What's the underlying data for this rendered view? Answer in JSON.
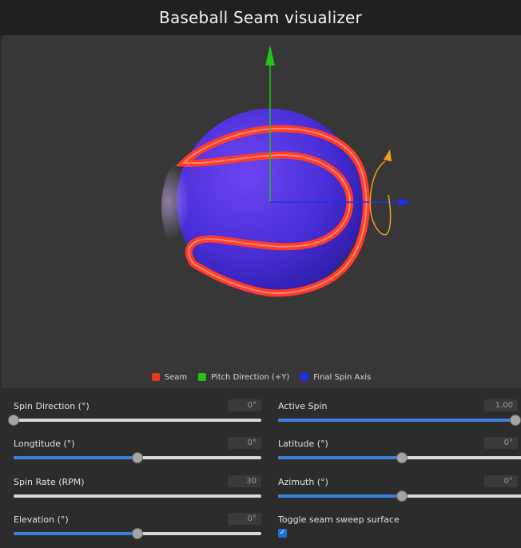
{
  "app": {
    "title": "Baseball Seam visualizer"
  },
  "legend": [
    {
      "label": "Seam",
      "color": "#e8391f"
    },
    {
      "label": "Pitch Direction (+Y)",
      "color": "#22c21a"
    },
    {
      "label": "Final Spin Axis",
      "color": "#1f2ff0"
    }
  ],
  "colors": {
    "seam": "#ff3b2a",
    "pitch_axis": "#22c21a",
    "spin_axis": "#1f2ff0",
    "spin_arrow": "#f0a020",
    "slider_fill": "#3c82dc"
  },
  "controls": {
    "spin_direction": {
      "label": "Spin Direction (°)",
      "value": "0°",
      "level": 0.0
    },
    "active_spin": {
      "label": "Active Spin",
      "value": "1.00",
      "level": 1.0
    },
    "longitude": {
      "label": "Longtitude (°)",
      "value": "0°",
      "level": 0.5
    },
    "latitude": {
      "label": "Latitude (°)",
      "value": "0°",
      "level": 0.5
    },
    "spin_rate": {
      "label": "Spin Rate (RPM)",
      "value": "30",
      "level": 0.0
    },
    "azimuth": {
      "label": "Azimuth (°)",
      "value": "0°",
      "level": 0.5
    },
    "elevation": {
      "label": "Elevation (°)",
      "value": "0°",
      "level": 0.5
    },
    "toggle_sweep": {
      "label": "Toggle seam sweep surface",
      "checked": true,
      "mark": "✓"
    }
  }
}
